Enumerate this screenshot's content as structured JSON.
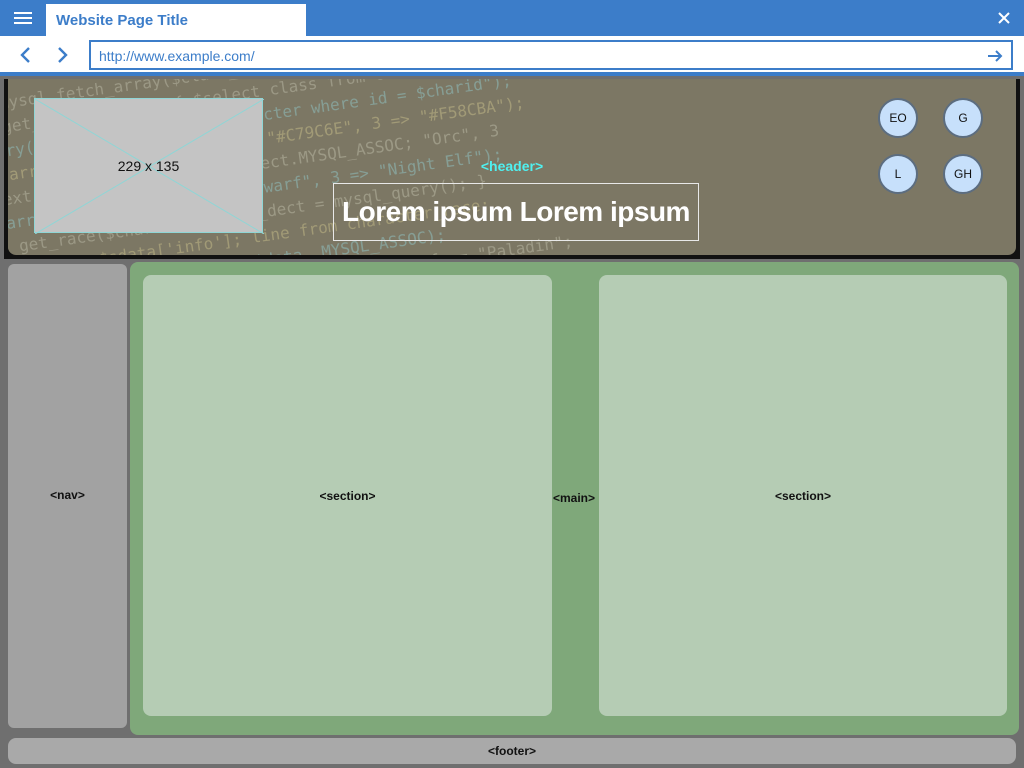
{
  "browser": {
    "tab_title": "Website Page Title",
    "url": "http://www.example.com/",
    "icons": {
      "menu": "hamburger-menu-icon",
      "close": "close-icon",
      "back": "chevron-left-icon",
      "forward": "chevron-right-icon",
      "go": "arrow-right-icon"
    },
    "accent_color": "#3c7dc9"
  },
  "header": {
    "tag_label": "<header>",
    "image_placeholder_label": "229 x 135",
    "hero_title": "Lorem ipsum Lorem ipsum",
    "buttons": [
      {
        "label": "EO"
      },
      {
        "label": "G"
      },
      {
        "label": "L"
      },
      {
        "label": "GH"
      }
    ]
  },
  "layout_labels": {
    "nav": "<nav>",
    "main": "<main>",
    "section_left": "<section>",
    "section_right": "<section>",
    "footer": "<footer>"
  },
  "colors": {
    "header_bg": "#7c7764",
    "nav_bg": "#a2a2a2",
    "main_bg": "#7fa87a",
    "section_bg": "#b5ccb4",
    "footer_bg": "#a9a9a9",
    "header_tag": "#4ff0f0",
    "circle_button_bg": "#c7e0fb"
  }
}
